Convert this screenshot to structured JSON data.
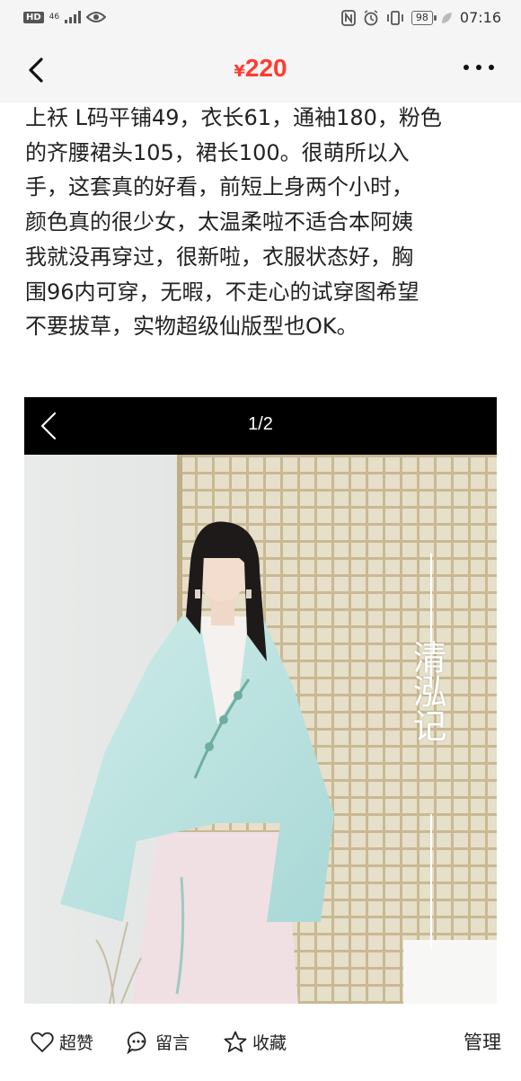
{
  "status_bar": {
    "badge": "HD",
    "network": "46",
    "battery": "98",
    "time": "07:16"
  },
  "nav": {
    "currency_symbol": "¥",
    "price": "220"
  },
  "description": {
    "lines": [
      "上袄 L码平铺49，衣长61，通袖180，粉色",
      "的齐腰裙头105，裙长100。很萌所以入",
      "手，这套真的好看，前短上身两个小时，",
      "颜色真的很少女，太温柔啦不适合本阿姨",
      "我就没再穿过，很新啦，衣服状态好，胸",
      "围96内可穿，无暇，不走心的试穿图希望",
      "不要拔草，实物超级仙版型也OK。"
    ]
  },
  "photo": {
    "counter": "1/2",
    "overlay_text": "清泓记"
  },
  "bottom_bar": {
    "like_label": "超赞",
    "comment_label": "留言",
    "favorite_label": "收藏",
    "manage_label": "管理"
  },
  "colors": {
    "price": "#ff3b2f",
    "bar_bg": "#f5f5f5"
  }
}
